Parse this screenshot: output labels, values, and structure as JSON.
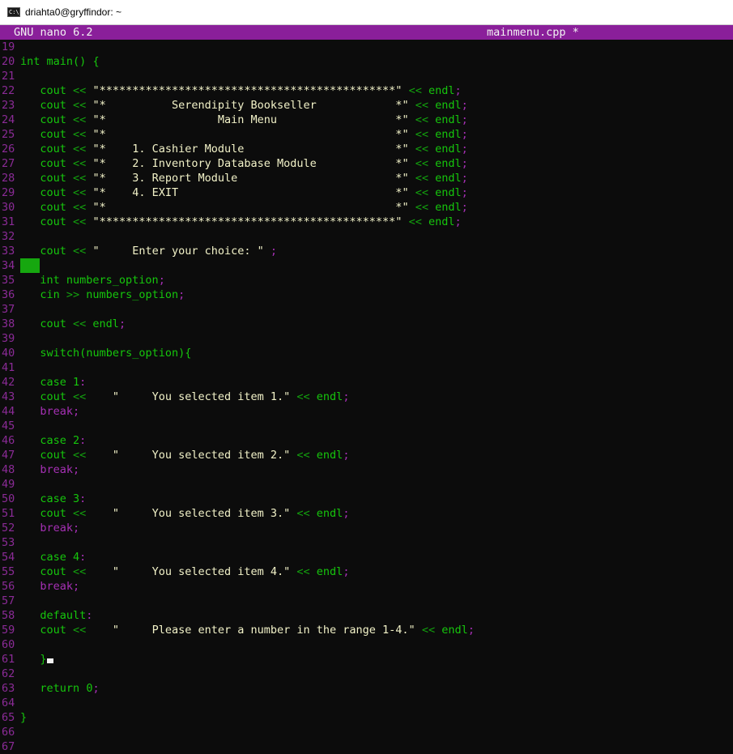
{
  "window": {
    "title": "driahta0@gryffindor: ~"
  },
  "nano": {
    "version": "GNU nano 6.2",
    "filename": "mainmenu.cpp *"
  },
  "lines": [
    {
      "n": "19",
      "code": ""
    },
    {
      "n": "20",
      "code": "int main() {"
    },
    {
      "n": "21",
      "code": ""
    },
    {
      "n": "22",
      "code": "   cout << \"*********************************************\" << endl;"
    },
    {
      "n": "23",
      "code": "   cout << \"*          Serendipity Bookseller            *\" << endl;"
    },
    {
      "n": "24",
      "code": "   cout << \"*                 Main Menu                  *\" << endl;"
    },
    {
      "n": "25",
      "code": "   cout << \"*                                            *\" << endl;"
    },
    {
      "n": "26",
      "code": "   cout << \"*    1. Cashier Module                       *\" << endl;"
    },
    {
      "n": "27",
      "code": "   cout << \"*    2. Inventory Database Module            *\" << endl;"
    },
    {
      "n": "28",
      "code": "   cout << \"*    3. Report Module                        *\" << endl;"
    },
    {
      "n": "29",
      "code": "   cout << \"*    4. EXIT                                 *\" << endl;"
    },
    {
      "n": "30",
      "code": "   cout << \"*                                            *\" << endl;"
    },
    {
      "n": "31",
      "code": "   cout << \"*********************************************\" << endl;"
    },
    {
      "n": "32",
      "code": ""
    },
    {
      "n": "33",
      "code": "   cout << \"     Enter your choice: \" ;"
    },
    {
      "n": "34",
      "code": ""
    },
    {
      "n": "35",
      "code": "   int numbers_option;"
    },
    {
      "n": "36",
      "code": "   cin >> numbers_option;"
    },
    {
      "n": "37",
      "code": ""
    },
    {
      "n": "38",
      "code": "   cout << endl;"
    },
    {
      "n": "39",
      "code": ""
    },
    {
      "n": "40",
      "code": "   switch(numbers_option){"
    },
    {
      "n": "41",
      "code": ""
    },
    {
      "n": "42",
      "code": "   case 1:"
    },
    {
      "n": "43",
      "code": "   cout <<    \"     You selected item 1.\" << endl;"
    },
    {
      "n": "44",
      "code": "   break;"
    },
    {
      "n": "45",
      "code": ""
    },
    {
      "n": "46",
      "code": "   case 2:"
    },
    {
      "n": "47",
      "code": "   cout <<    \"     You selected item 2.\" << endl;"
    },
    {
      "n": "48",
      "code": "   break;"
    },
    {
      "n": "49",
      "code": ""
    },
    {
      "n": "50",
      "code": "   case 3:"
    },
    {
      "n": "51",
      "code": "   cout <<    \"     You selected item 3.\" << endl;"
    },
    {
      "n": "52",
      "code": "   break;"
    },
    {
      "n": "53",
      "code": ""
    },
    {
      "n": "54",
      "code": "   case 4:"
    },
    {
      "n": "55",
      "code": "   cout <<    \"     You selected item 4.\" << endl;"
    },
    {
      "n": "56",
      "code": "   break;"
    },
    {
      "n": "57",
      "code": ""
    },
    {
      "n": "58",
      "code": "   default:"
    },
    {
      "n": "59",
      "code": "   cout <<    \"     Please enter a number in the range 1-4.\" << endl;"
    },
    {
      "n": "60",
      "code": ""
    },
    {
      "n": "61",
      "code": "   }"
    },
    {
      "n": "62",
      "code": ""
    },
    {
      "n": "63",
      "code": "   return 0;"
    },
    {
      "n": "64",
      "code": ""
    },
    {
      "n": "65",
      "code": "}"
    },
    {
      "n": "66",
      "code": ""
    },
    {
      "n": "67",
      "code": ""
    }
  ],
  "colors": {
    "header_bg": "#8a1f9a",
    "line_number": "#8b2b97",
    "code_green": "#16c60c",
    "string_text": "#f2f2c8",
    "keyword_purple": "#a630b5",
    "background": "#0c0c0c"
  },
  "icons": {
    "window_icon": "terminal-icon"
  }
}
